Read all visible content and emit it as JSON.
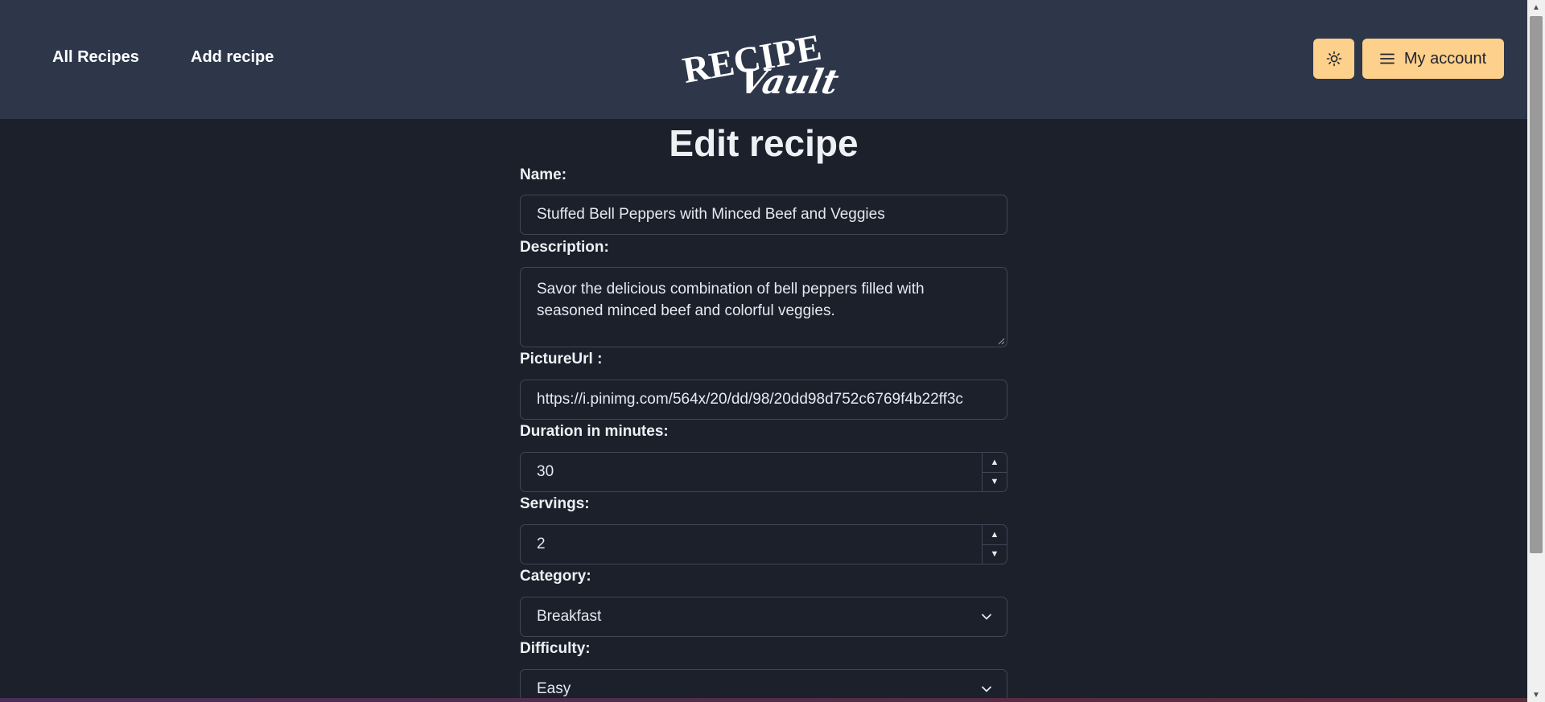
{
  "nav": {
    "all_recipes": "All Recipes",
    "add_recipe": "Add recipe"
  },
  "logo": {
    "line1": "RECIPE",
    "line2": "Vault"
  },
  "header": {
    "theme_icon": "sun-icon",
    "account_icon": "menu-icon",
    "account_label": "My account"
  },
  "form": {
    "title": "Edit recipe",
    "name_label": "Name:",
    "name_value": "Stuffed Bell Peppers with Minced Beef and Veggies",
    "description_label": "Description:",
    "description_value": "Savor the delicious combination of bell peppers filled with seasoned minced beef and colorful veggies.",
    "picture_label": "PictureUrl :",
    "picture_value": "https://i.pinimg.com/564x/20/dd/98/20dd98d752c6769f4b22ff3c",
    "duration_label": "Duration in minutes:",
    "duration_value": "30",
    "servings_label": "Servings:",
    "servings_value": "2",
    "category_label": "Category:",
    "category_value": "Breakfast",
    "difficulty_label": "Difficulty:",
    "difficulty_value": "Easy"
  },
  "colors": {
    "header_bg": "#2e374a",
    "page_bg": "#1b202b",
    "accent": "#fdd08b",
    "border": "#3f4757"
  }
}
